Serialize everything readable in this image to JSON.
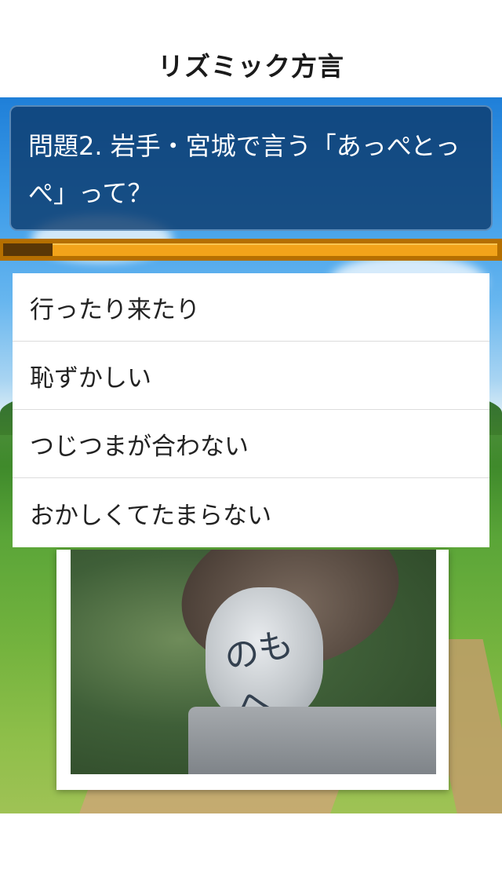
{
  "nav": {
    "title": "リズミック方言"
  },
  "question": {
    "text": "問題2. 岩手・宮城で言う「あっぺとっぺ」って？"
  },
  "progress": {
    "fraction": 0.1
  },
  "answers": [
    {
      "label": "行ったり来たり"
    },
    {
      "label": "恥ずかしい"
    },
    {
      "label": "つじつまが合わない"
    },
    {
      "label": "おかしくてたまらない"
    }
  ],
  "photo": {
    "face_text": "のもへ"
  },
  "colors": {
    "question_bg": "#0e3c6e",
    "progress_track": "#b56f00",
    "progress_bar": "#f2a31a",
    "progress_fill": "#5a3706"
  }
}
